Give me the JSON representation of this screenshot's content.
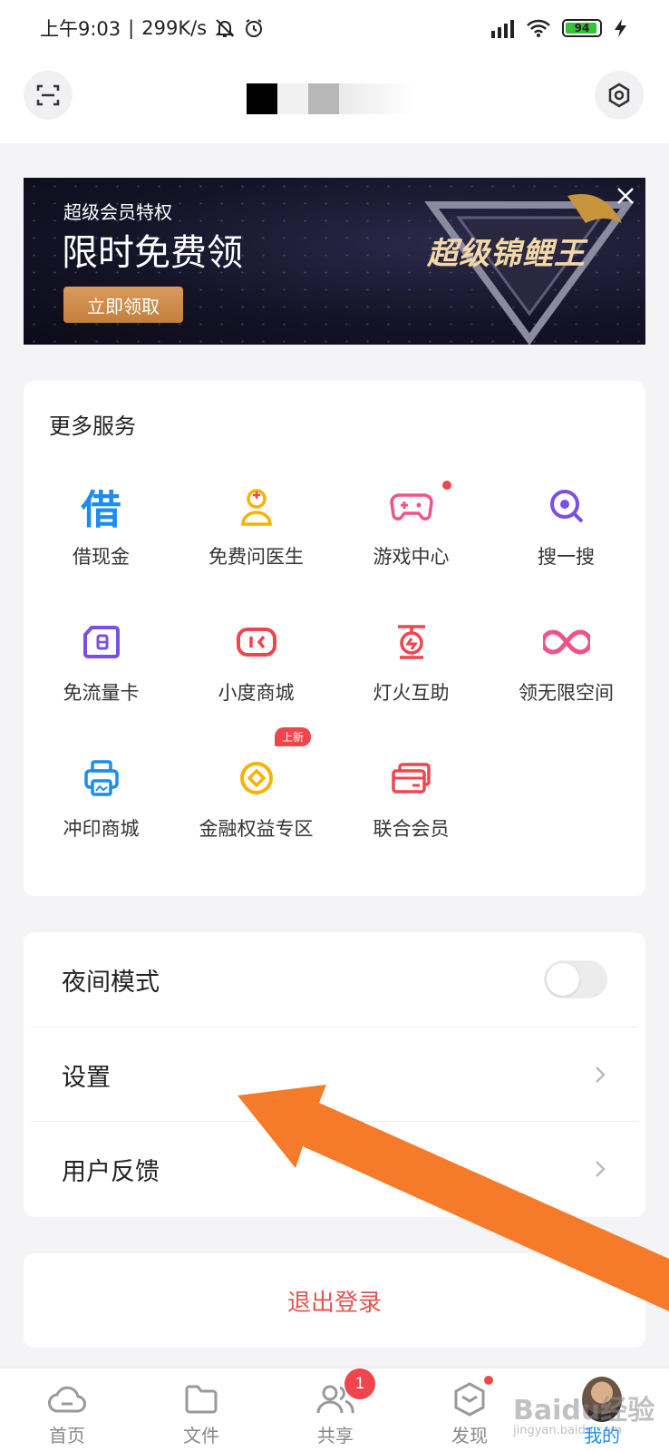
{
  "status_bar": {
    "time": "上午9:03",
    "net_speed": "299K/s",
    "battery": "94"
  },
  "header": {
    "scan_icon": "scan-icon",
    "settings_icon": "settings-hex-icon"
  },
  "banner": {
    "subtitle": "超级会员特权",
    "title": "限时免费领",
    "button": "立即领取",
    "brand": "超级锦鲤王"
  },
  "services": {
    "title": "更多服务",
    "items": [
      {
        "label": "借现金",
        "icon": "borrow-icon",
        "color": "#1c8cf0"
      },
      {
        "label": "免费问医生",
        "icon": "doctor-icon",
        "color": "#f5b400"
      },
      {
        "label": "游戏中心",
        "icon": "gamepad-icon",
        "color": "#f0528a"
      },
      {
        "label": "搜一搜",
        "icon": "search-icon",
        "color": "#7b4ee6"
      },
      {
        "label": "免流量卡",
        "icon": "simcard-icon",
        "color": "#7b4ee6"
      },
      {
        "label": "小度商城",
        "icon": "xiaodu-icon",
        "color": "#f0454c"
      },
      {
        "label": "灯火互助",
        "icon": "lamp-icon",
        "color": "#f0454c"
      },
      {
        "label": "领无限空间",
        "icon": "infinity-icon",
        "color": "#f0528a"
      },
      {
        "label": "冲印商城",
        "icon": "printer-icon",
        "color": "#1c8cf0"
      },
      {
        "label": "金融权益专区",
        "icon": "coin-icon",
        "color": "#f5b400"
      },
      {
        "label": "联合会员",
        "icon": "card-icon",
        "color": "#f0454c"
      }
    ],
    "new_tag": "上新"
  },
  "settings": {
    "night_mode": "夜间模式",
    "settings": "设置",
    "feedback": "用户反馈"
  },
  "logout": "退出登录",
  "tabbar": {
    "tabs": [
      {
        "label": "首页",
        "icon": "home-cloud-icon"
      },
      {
        "label": "文件",
        "icon": "folder-icon"
      },
      {
        "label": "共享",
        "icon": "share-people-icon"
      },
      {
        "label": "发现",
        "icon": "discover-box-icon"
      },
      {
        "label": "我的",
        "icon": "avatar"
      }
    ],
    "share_badge": "1"
  },
  "watermark": {
    "line1": "Baidu经验",
    "line2": "jingyan.baidu.com"
  },
  "colors": {
    "accent": "#1c8cf0",
    "danger": "#e35450",
    "arrow": "#f57a2a"
  }
}
